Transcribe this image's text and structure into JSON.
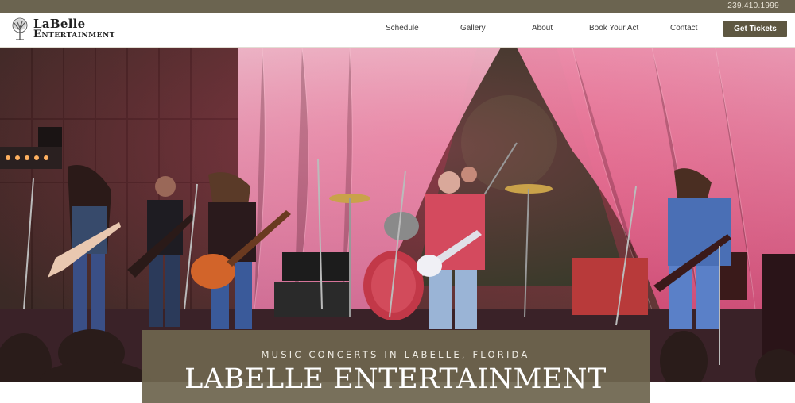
{
  "topbar": {
    "phone": "239.410.1999"
  },
  "brand": {
    "line1": "LaBelle",
    "line2": "Entertainment",
    "logo_icon": "tree-icon"
  },
  "nav": {
    "items": [
      {
        "label": "Schedule"
      },
      {
        "label": "Gallery"
      },
      {
        "label": "About"
      },
      {
        "label": "Book Your Act"
      },
      {
        "label": "Contact"
      }
    ],
    "cta_label": "Get Tickets"
  },
  "hero": {
    "image_alt": "band-performing-on-stage",
    "subtitle": "MUSIC CONCERTS IN LABELLE, FLORIDA",
    "title": "LABELLE ENTERTAINMENT"
  },
  "colors": {
    "topbar": "#6b6450",
    "cta": "#5e5741",
    "caption_bg": "#6e654f"
  }
}
